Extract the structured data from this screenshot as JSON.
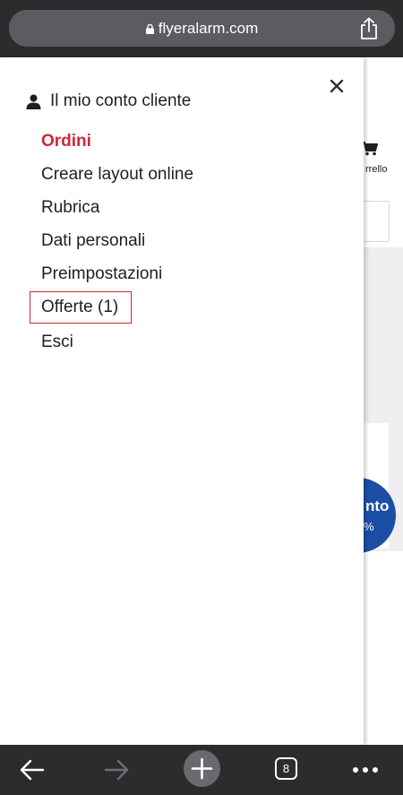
{
  "browser": {
    "url": "flyeralarm.com",
    "tab_count": "8"
  },
  "background": {
    "cart_label": "rrello",
    "badge_text": "nto",
    "badge_sub": "%"
  },
  "account_menu": {
    "title": "Il mio conto cliente",
    "items": [
      {
        "label": "Ordini"
      },
      {
        "label": "Creare layout online"
      },
      {
        "label": "Rubrica"
      },
      {
        "label": "Dati personali"
      },
      {
        "label": "Preimpostazioni"
      },
      {
        "label": "Offerte (1)"
      },
      {
        "label": "Esci"
      }
    ]
  },
  "colors": {
    "accent": "#d0263a",
    "chrome": "#2c2c2e",
    "badge": "#1d4ea6"
  }
}
